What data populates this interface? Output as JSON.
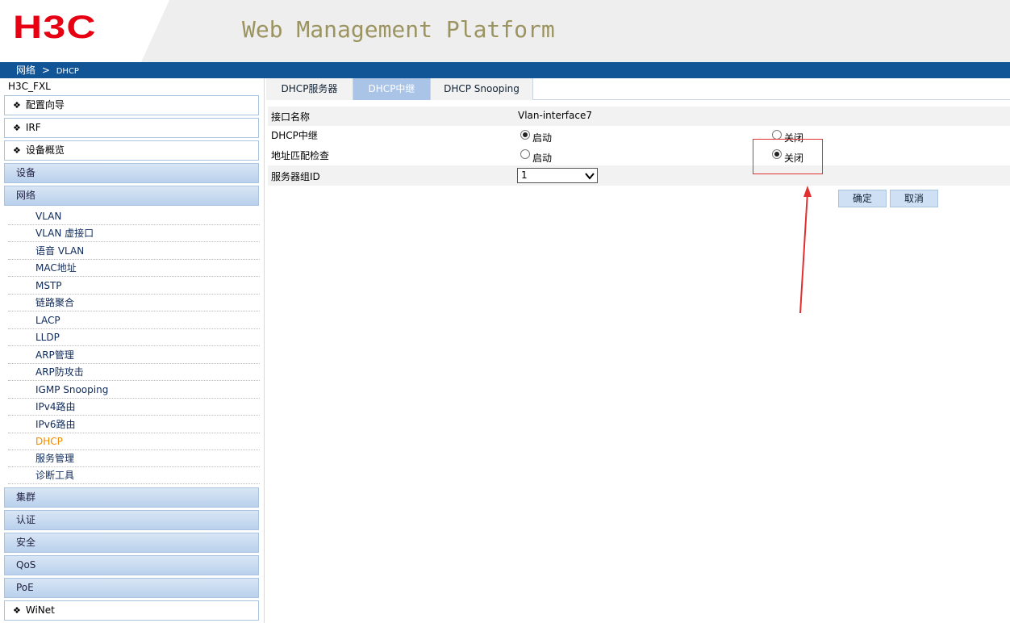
{
  "header": {
    "logo": "H3C",
    "title": "Web Management Platform"
  },
  "breadcrumb": {
    "items": [
      "网络",
      ">",
      "DHCP"
    ]
  },
  "sidebar": {
    "device_name": "H3C_FXL",
    "top_items": [
      "配置向导",
      "IRF",
      "设备概览"
    ],
    "categories_top": [
      "设备",
      "网络"
    ],
    "network_items": [
      "VLAN",
      "VLAN 虚接口",
      "语音 VLAN",
      "MAC地址",
      "MSTP",
      "链路聚合",
      "LACP",
      "LLDP",
      "ARP管理",
      "ARP防攻击",
      "IGMP Snooping",
      "IPv4路由",
      "IPv6路由",
      "DHCP",
      "服务管理",
      "诊断工具"
    ],
    "active_item": "DHCP",
    "categories_bottom": [
      "集群",
      "认证",
      "安全",
      "QoS",
      "PoE"
    ],
    "bottom_item": "WiNet"
  },
  "tabs": [
    {
      "label": "DHCP服务器",
      "active": false
    },
    {
      "label": "DHCP中继",
      "active": true
    },
    {
      "label": "DHCP Snooping",
      "active": false
    }
  ],
  "form": {
    "interface_label": "接口名称",
    "interface_value": "Vlan-interface7",
    "relay_label": "DHCP中继",
    "relay_on": "启动",
    "relay_off": "关闭",
    "relay_state": "on",
    "check_label": "地址匹配检查",
    "check_on": "启动",
    "check_off": "关闭",
    "check_state": "off",
    "server_group_label": "服务器组ID",
    "server_group_value": "1"
  },
  "buttons": {
    "ok": "确定",
    "cancel": "取消"
  },
  "colors": {
    "brand_red": "#e60012",
    "nav_blue": "#115597",
    "active_orange": "#f08c00",
    "annotation_red": "#e03030"
  }
}
